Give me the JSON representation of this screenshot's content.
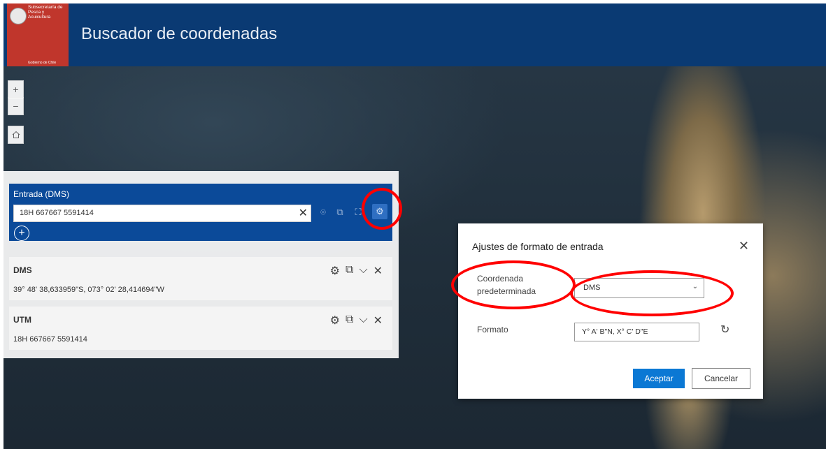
{
  "header": {
    "org_name": "Subsecretaría de Pesca y Acuicultura",
    "gov_label": "Gobierno de Chile",
    "title": "Buscador de coordenadas"
  },
  "map_controls": {
    "zoom_in": "+",
    "zoom_out": "−",
    "home_icon": "home-icon"
  },
  "input_panel": {
    "label": "Entrada (DMS)",
    "value": "18H 667667 5591414",
    "icons": [
      "close-icon",
      "map-pin-icon",
      "copy-icon",
      "expand-icon",
      "settings-icon"
    ],
    "add_label": "+"
  },
  "outputs": [
    {
      "title": "DMS",
      "value": "39° 48' 38,633959\"S, 073° 02' 28,414694\"W"
    },
    {
      "title": "UTM",
      "value": "18H 667667 5591414"
    }
  ],
  "dialog": {
    "title": "Ajustes de formato de entrada",
    "default_coord_label": "Coordenada predeterminada",
    "default_coord_value": "DMS",
    "format_label": "Formato",
    "format_value": "Y° A' B\"N, X° C' D\"E",
    "accept_label": "Aceptar",
    "cancel_label": "Cancelar"
  },
  "colors": {
    "header_bg": "#0a3a73",
    "input_card_bg": "#0b4a99",
    "primary_button": "#0b78d4",
    "annotation": "#ff0000"
  }
}
